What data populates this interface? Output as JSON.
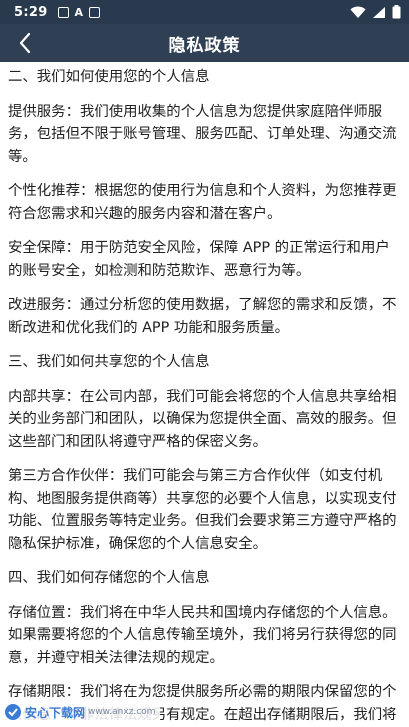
{
  "status_bar": {
    "time": "5:29",
    "notif_a_label": "A"
  },
  "header": {
    "title": "隐私政策"
  },
  "paragraphs": [
    "二、我们如何使用您的个人信息",
    "提供服务：我们使用收集的个人信息为您提供家庭陪伴师服务，包括但不限于账号管理、服务匹配、订单处理、沟通交流等。",
    "个性化推荐：根据您的使用行为信息和个人资料，为您推荐更符合您需求和兴趣的服务内容和潜在客户。",
    "安全保障：用于防范安全风险，保障 APP 的正常运行和用户的账号安全，如检测和防范欺诈、恶意行为等。",
    "改进服务：通过分析您的使用数据，了解您的需求和反馈，不断改进和优化我们的 APP 功能和服务质量。",
    "三、我们如何共享您的个人信息",
    "内部共享：在公司内部，我们可能会将您的个人信息共享给相关的业务部门和团队，以确保为您提供全面、高效的服务。但这些部门和团队将遵守严格的保密义务。",
    "第三方合作伙伴：我们可能会与第三方合作伙伴（如支付机构、地图服务提供商等）共享您的必要个人信息，以实现支付功能、位置服务等特定业务。但我们会要求第三方遵守严格的隐私保护标准，确保您的个人信息安全。",
    "四、我们如何存储您的个人信息",
    "存储位置：我们将在中华人民共和国境内存储您的个人信息。如果需要将您的个人信息传输至境外，我们将另行获得您的同意，并遵守相关法律法规的规定。",
    "存储期限：我们将在为您提供服务所必需的期限内保留您的个人信息，除非法律法规另有规定。在超出存储期限后，我们将对您的个人信息进行删除或匿名化处理。"
  ],
  "watermark": {
    "text": "安心下载网",
    "sub": "www.anxz.com"
  },
  "colors": {
    "status_bar_bg": "#2a3a4e",
    "header_bg": "#2f3f54",
    "text": "#222222"
  }
}
